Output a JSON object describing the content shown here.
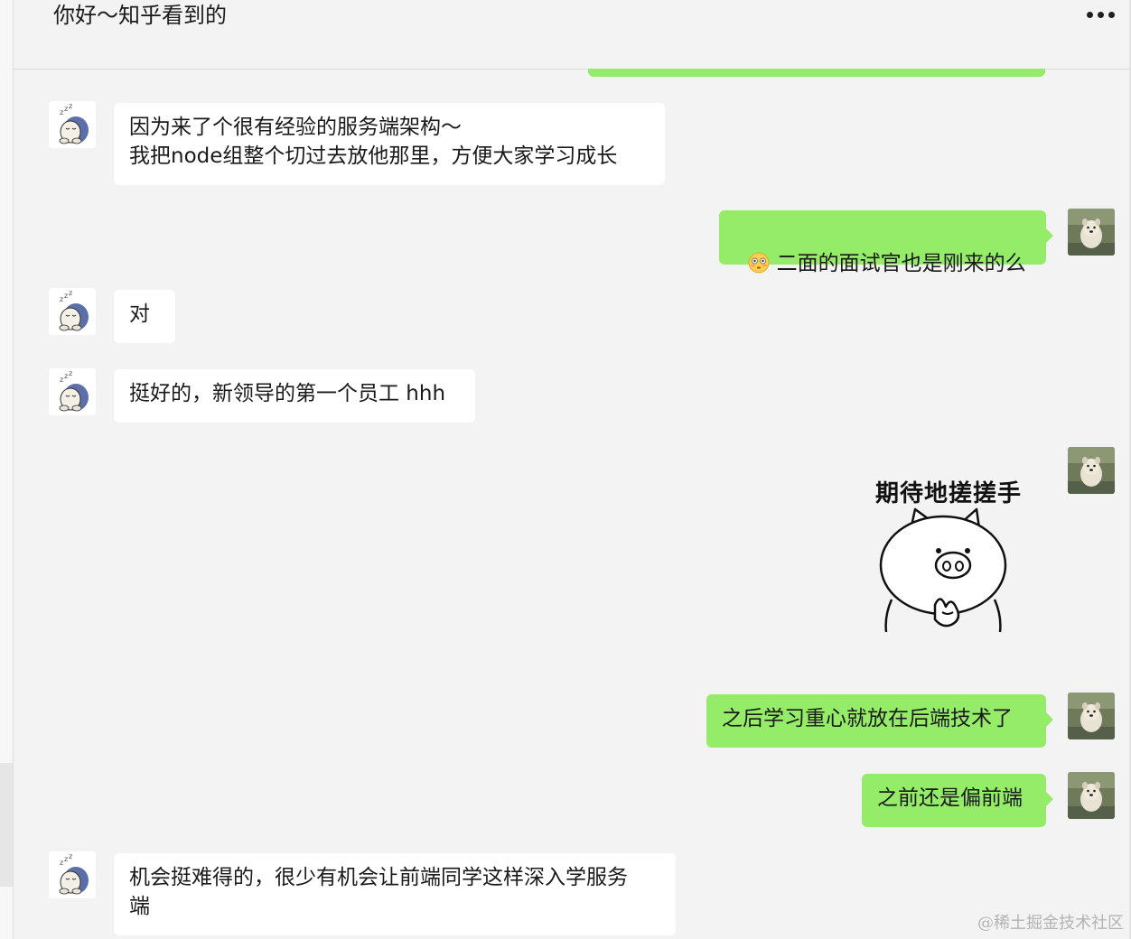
{
  "header": {
    "title": "你好～知乎看到的",
    "more_icon": "more-horizontal-icon"
  },
  "messages": [
    {
      "side": "left",
      "avatar": "sleeping-cartoon-avatar",
      "text": "因为来了个很有经验的服务端架构～\n我把node组整个切过去放他那里，方便大家学习成长"
    },
    {
      "side": "right",
      "avatar": "dog-photo-avatar",
      "emoji": "flushed-face-emoji",
      "text": "二面的面试官也是刚来的么"
    },
    {
      "side": "left",
      "avatar": "sleeping-cartoon-avatar",
      "text": "对"
    },
    {
      "side": "left",
      "avatar": "sleeping-cartoon-avatar",
      "text": "挺好的，新领导的第一个员工 hhh"
    },
    {
      "side": "right",
      "avatar": "dog-photo-avatar",
      "sticker": {
        "caption": "期待地搓搓手",
        "icon": "pig-rubbing-hands-sticker"
      }
    },
    {
      "side": "right",
      "avatar": "dog-photo-avatar",
      "text": "之后学习重心就放在后端技术了"
    },
    {
      "side": "right",
      "avatar": "dog-photo-avatar",
      "text": "之前还是偏前端"
    },
    {
      "side": "left",
      "avatar": "sleeping-cartoon-avatar",
      "text": "机会挺难得的，很少有机会让前端同学这样深入学服务\n端"
    }
  ],
  "watermark": "@稀土掘金技术社区",
  "colors": {
    "background": "#f3f3f3",
    "self_bubble": "#95ec69",
    "other_bubble": "#ffffff"
  }
}
